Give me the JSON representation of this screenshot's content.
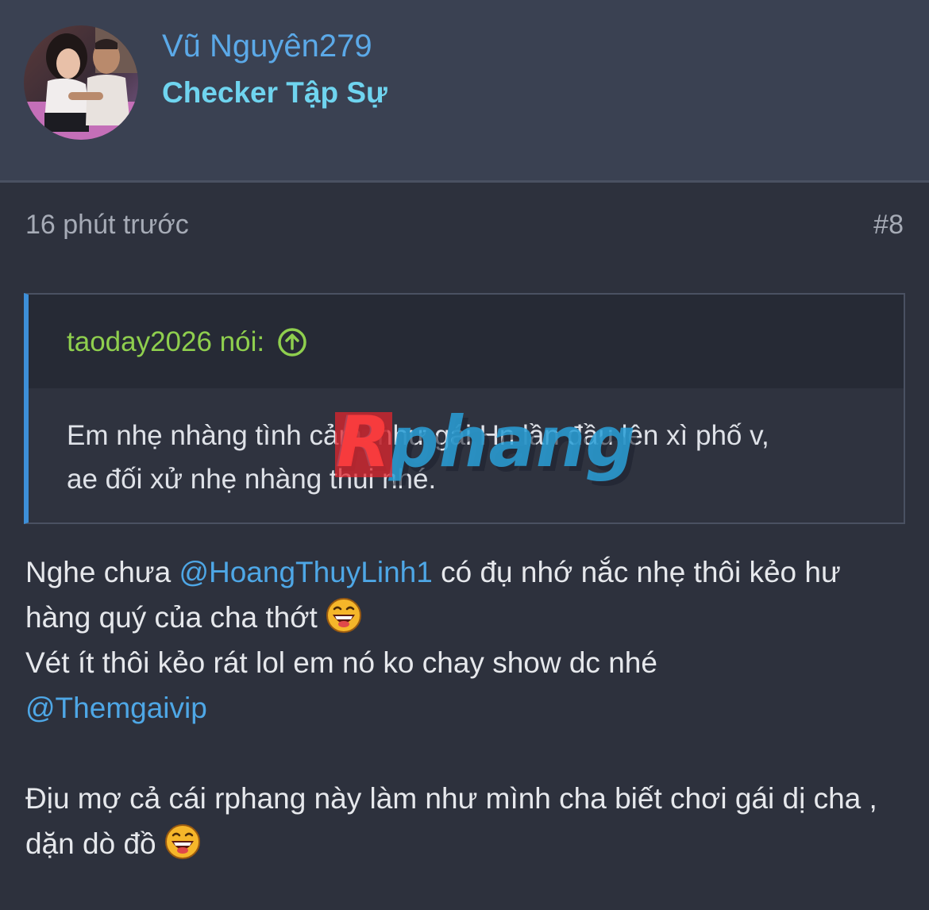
{
  "user": {
    "name": "Vũ Nguyên279",
    "title": "Checker Tập Sự"
  },
  "post_meta": {
    "time": "16 phút trước",
    "number": "#8"
  },
  "quote": {
    "author": "taoday2026 nói:",
    "line1": "Em nhẹ nhàng tình cảm, như gái Hn lần đầu lên xì phố v,",
    "line2": "ae đối xử nhẹ nhàng thui nhé.",
    "watermark": "Rphang"
  },
  "post": {
    "p1_a": "Nghe chưa ",
    "p1_mention": "@HoangThuyLinh1",
    "p1_b": " có đụ nhớ nắc nhẹ thôi kẻo hư hàng quý của cha thớt ",
    "p2_a": "Vét ít thôi kẻo rát lol em nó ko chay show dc nhé",
    "p2_mention": "@Themgaivip",
    "p3_a": "Địu mợ cả cái rphang này làm như mình cha biết chơi gái dị cha , dặn dò đồ "
  },
  "icons": {
    "avatar": "user-avatar",
    "quote_arrow": "arrow-up-circle-icon",
    "emoji": "laughing-emoji-icon"
  },
  "colors": {
    "header_bg": "#3a4152",
    "page_bg": "#2d313d",
    "username": "#5ba9e8",
    "title": "#6fd4ef",
    "quote_author": "#8fcf4e",
    "quote_border": "#3d8fd8",
    "mention": "#4ea7e6"
  }
}
